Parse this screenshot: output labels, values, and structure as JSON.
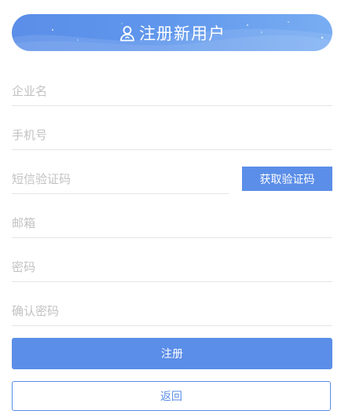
{
  "header": {
    "title": "注册新用户",
    "icon": "user-icon"
  },
  "form": {
    "company_name": {
      "placeholder": "企业名",
      "value": ""
    },
    "phone": {
      "placeholder": "手机号",
      "value": ""
    },
    "sms_code": {
      "placeholder": "短信验证码",
      "value": ""
    },
    "email": {
      "placeholder": "邮箱",
      "value": ""
    },
    "password": {
      "placeholder": "密码",
      "value": ""
    },
    "confirm_password": {
      "placeholder": "确认密码",
      "value": ""
    }
  },
  "buttons": {
    "get_code": "获取验证码",
    "register": "注册",
    "back": "返回"
  },
  "colors": {
    "accent": "#5b8ee8",
    "placeholder": "#c2c2c2",
    "divider": "#e6e6e6"
  }
}
